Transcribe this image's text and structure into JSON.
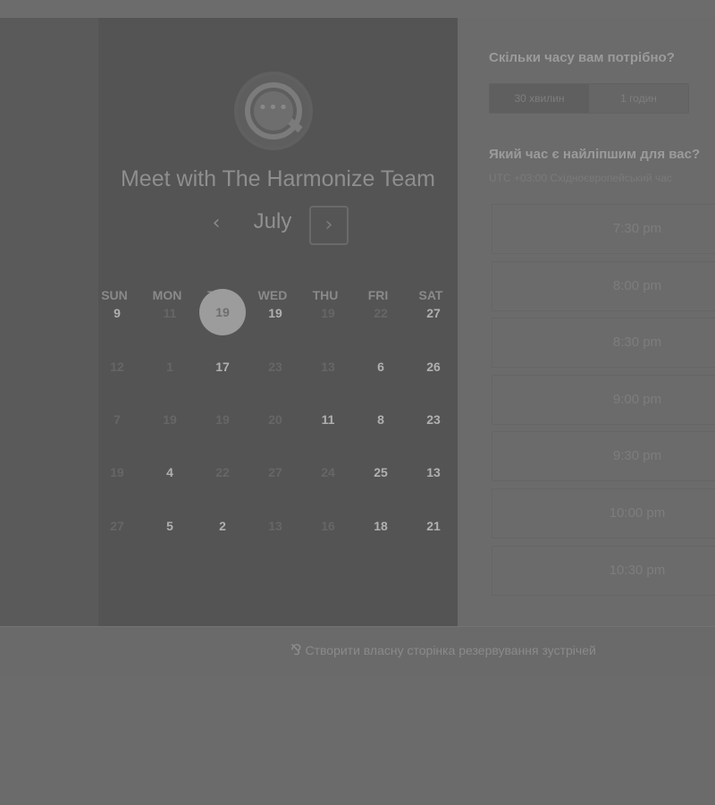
{
  "calendar": {
    "title": "Meet with The Harmonize Team",
    "month": "July",
    "prev_icon": "‹",
    "next_icon": "›",
    "logo_dots": "•••",
    "weekdays": [
      "SUN",
      "MON",
      "TUE",
      "WED",
      "THU",
      "FRI",
      "SAT"
    ],
    "weeks": [
      [
        {
          "t": "9",
          "s": "avail"
        },
        {
          "t": "11",
          "s": "unavail"
        },
        {
          "t": "19",
          "s": "selected"
        },
        {
          "t": "19",
          "s": "avail"
        },
        {
          "t": "19",
          "s": "unavail"
        },
        {
          "t": "22",
          "s": "unavail"
        },
        {
          "t": "27",
          "s": "avail"
        }
      ],
      [
        {
          "t": "12",
          "s": "unavail"
        },
        {
          "t": "1",
          "s": "unavail"
        },
        {
          "t": "17",
          "s": "avail"
        },
        {
          "t": "23",
          "s": "unavail"
        },
        {
          "t": "13",
          "s": "unavail"
        },
        {
          "t": "6",
          "s": "avail"
        },
        {
          "t": "26",
          "s": "avail"
        }
      ],
      [
        {
          "t": "7",
          "s": "unavail"
        },
        {
          "t": "19",
          "s": "unavail"
        },
        {
          "t": "19",
          "s": "unavail"
        },
        {
          "t": "20",
          "s": "unavail"
        },
        {
          "t": "11",
          "s": "avail"
        },
        {
          "t": "8",
          "s": "avail"
        },
        {
          "t": "23",
          "s": "avail"
        }
      ],
      [
        {
          "t": "19",
          "s": "unavail"
        },
        {
          "t": "4",
          "s": "avail"
        },
        {
          "t": "22",
          "s": "unavail"
        },
        {
          "t": "27",
          "s": "unavail"
        },
        {
          "t": "24",
          "s": "unavail"
        },
        {
          "t": "25",
          "s": "avail"
        },
        {
          "t": "13",
          "s": "avail"
        }
      ],
      [
        {
          "t": "27",
          "s": "unavail"
        },
        {
          "t": "5",
          "s": "avail"
        },
        {
          "t": "2",
          "s": "avail"
        },
        {
          "t": "13",
          "s": "unavail"
        },
        {
          "t": "16",
          "s": "unavail"
        },
        {
          "t": "18",
          "s": "avail"
        },
        {
          "t": "21",
          "s": "avail"
        }
      ]
    ]
  },
  "booking": {
    "duration_question": "Скільки часу вам потрібно?",
    "duration_options": [
      {
        "label": "30 хвилин",
        "active": true
      },
      {
        "label": "1 годин",
        "active": false
      }
    ],
    "time_question": "Який час є найліпшим для вас?",
    "timezone": "UTC +03:00 Східноєвропейський час",
    "slots": [
      "7:30 pm",
      "8:00 pm",
      "8:30 pm",
      "9:00 pm",
      "9:30 pm",
      "10:00 pm",
      "10:30 pm"
    ]
  },
  "footer": {
    "link_text": "Створити власну сторінка резервування зустрічей",
    "icon_glyph": "⅋"
  }
}
